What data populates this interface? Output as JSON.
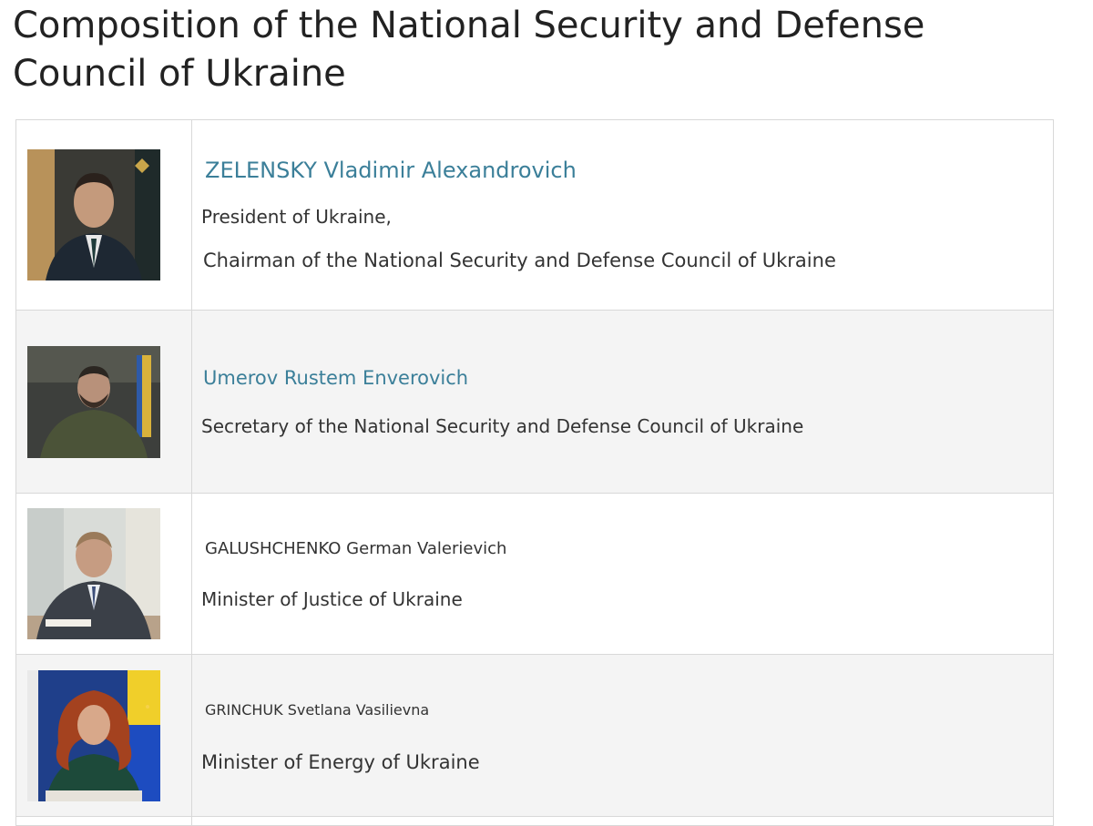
{
  "page": {
    "title": "Composition of the National Security and Defense Council of Ukraine"
  },
  "members": [
    {
      "name": "ZELENSKY Vladimir Alexandrovich",
      "roles": [
        "President of Ukraine,",
        "Chairman of the National Security and Defense Council of Ukraine"
      ]
    },
    {
      "name": "Umerov Rustem Enverovich",
      "roles": [
        "Secretary of the National Security and Defense Council of Ukraine"
      ]
    },
    {
      "name": "GALUSHCHENKO German Valerievich",
      "roles": [
        "Minister of Justice of Ukraine"
      ]
    },
    {
      "name": "GRINCHUK Svetlana Vasilievna",
      "roles": [
        "Minister of Energy of Ukraine"
      ]
    }
  ],
  "colors": {
    "name_link": "#3b7f99",
    "text": "#333333",
    "row_alt": "#f4f4f4",
    "border": "#d8d8d8"
  }
}
